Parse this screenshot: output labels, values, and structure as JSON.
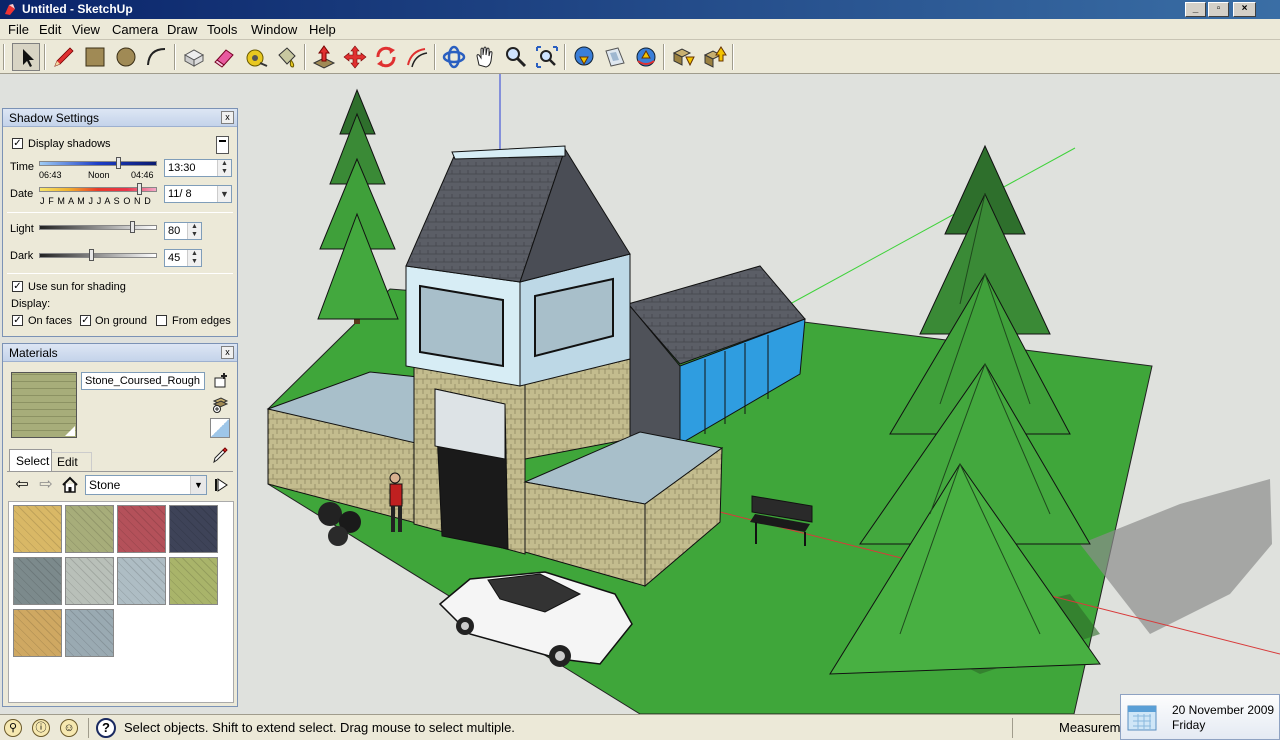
{
  "window": {
    "title": "Untitled - SketchUp",
    "minimize_glyph": "_",
    "maximize_glyph": "▫",
    "close_glyph": "×"
  },
  "menu": [
    "File",
    "Edit",
    "View",
    "Camera",
    "Draw",
    "Tools",
    "Window",
    "Help"
  ],
  "toolbar": {
    "tools": [
      "select-icon",
      "pencil-line-icon",
      "rectangle-icon",
      "circle-icon",
      "arc-icon",
      "make-component-icon",
      "eraser-icon",
      "tape-measure-icon",
      "paint-bucket-icon",
      "push-pull-icon",
      "move-icon",
      "rotate-icon",
      "offset-icon",
      "orbit-icon",
      "pan-icon",
      "zoom-icon",
      "zoom-extents-icon",
      "get-models-icon",
      "share-model-icon",
      "get-photo-texture-icon",
      "get-components-icon",
      "share-component-icon"
    ],
    "active_tool": "select-icon"
  },
  "shadow_settings": {
    "title": "Shadow Settings",
    "close_glyph": "x",
    "check_glyph": "✓",
    "display_shadows_label": "Display shadows",
    "display_shadows": true,
    "time_label": "Time",
    "time_start": "06:43",
    "time_noon": "Noon",
    "time_end": "04:46",
    "time_value": "13:30",
    "time_slider_fraction": 0.68,
    "date_label": "Date",
    "months": "J F M A M J J A S O N D",
    "date_value": "11/ 8",
    "date_slider_fraction": 0.86,
    "light_label": "Light",
    "light_value": "80",
    "light_fraction": 0.8,
    "dark_label": "Dark",
    "dark_value": "45",
    "dark_fraction": 0.45,
    "use_sun_label": "Use sun for shading",
    "use_sun": true,
    "display_label": "Display:",
    "on_faces_label": "On faces",
    "on_faces": true,
    "on_ground_label": "On ground",
    "on_ground": true,
    "from_edges_label": "From edges",
    "from_edges": false
  },
  "materials": {
    "title": "Materials",
    "close_glyph": "x",
    "current_material": "Stone_Coursed_Rough",
    "tabs": [
      "Select",
      "Edit"
    ],
    "active_tab": "Select",
    "library": "Stone",
    "swatch_colors": [
      "#d9b866",
      "#a7ad7a",
      "#b4515a",
      "#3e4358",
      "#7c8a8c",
      "#b9c0b9",
      "#aebdc4",
      "#a9b46a",
      "#cfa862",
      "#9aaab2"
    ]
  },
  "statusbar": {
    "hint": "Select objects. Shift to extend select. Drag mouse to select multiple.",
    "measurements_label": "Measurem",
    "help_glyph": "?"
  },
  "notification": {
    "date": "20 November 2009",
    "day": "Friday"
  },
  "colors": {
    "grass": "#3fa63a",
    "sky": "#dfe1dd",
    "stone": "#c3bc8e",
    "roof": "#5b5e66",
    "glass_blue": "#2f9de0",
    "tree": "#3fa83a",
    "titlebar": "#0a246a"
  }
}
